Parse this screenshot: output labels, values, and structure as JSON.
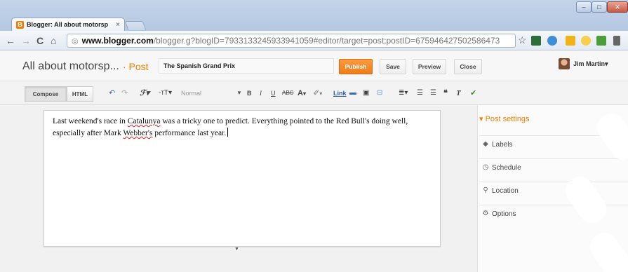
{
  "browser": {
    "tab_title": "Blogger: All about motorsp",
    "tab_close": "×",
    "favicon": "B",
    "nav": {
      "back": "←",
      "forward": "→",
      "reload": "C",
      "home": "⌂"
    },
    "url_host": "www.blogger.com",
    "url_path": "/blogger.g?blogID=7933133245933941059#editor/target=post;postID=675946427502586473",
    "window_controls": {
      "min": "–",
      "max": "□",
      "close": "✕"
    }
  },
  "header": {
    "blog_name": "All about motorsp...",
    "separator_link": "· Post",
    "post_title": "The Spanish Grand Prix",
    "publish": "Publish",
    "save": "Save",
    "preview": "Preview",
    "close": "Close",
    "user": "Jim Martin▾"
  },
  "format_bar": {
    "compose": "Compose",
    "html": "HTML",
    "font_size": "Normal",
    "link": "Link"
  },
  "editor": {
    "line1_a": "Last weekend's race in ",
    "line1_sp": "Catalunya",
    "line1_b": " was a tricky one to predict. Everything pointed to the Red Bull's doing well,",
    "line2_a": "especially after Mark ",
    "line2_sp": "Webber's",
    "line2_b": " performance last year."
  },
  "sidebar": {
    "heading": "Post settings",
    "items": [
      {
        "label": "Labels",
        "icon": "tag-icon"
      },
      {
        "label": "Schedule",
        "icon": "clock-icon"
      },
      {
        "label": "Location",
        "icon": "pin-icon"
      },
      {
        "label": "Options",
        "icon": "gear-icon"
      }
    ]
  },
  "colors": {
    "accent": "#f57d00",
    "publish": "#f07d1b",
    "chrome_frame": "#b5c8e2"
  }
}
